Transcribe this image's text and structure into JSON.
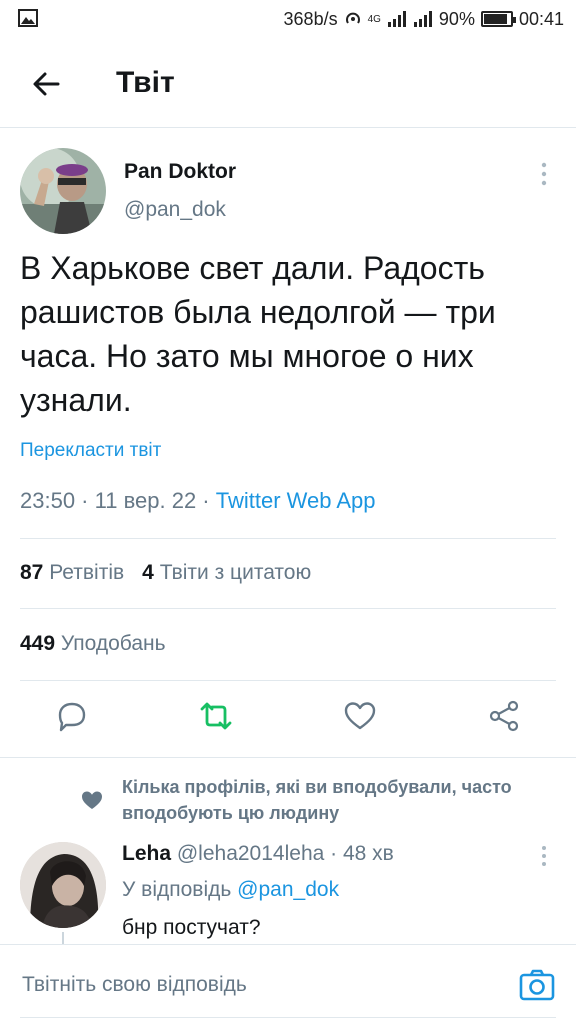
{
  "status_bar": {
    "speed": "368b/s",
    "network": "4G",
    "battery": "90%",
    "battery_level": 0.9,
    "time": "00:41"
  },
  "header": {
    "title": "Твіт"
  },
  "tweet": {
    "author_name": "Pan Doktor",
    "author_handle": "@pan_dok",
    "text": "В Харькове свет дали. Радость рашистов была недолгой — три часа. Но зато мы многое о них узнали.",
    "translate_label": "Перекласти твіт",
    "time": "23:50",
    "date": "11 вер. 22",
    "source": "Twitter Web App",
    "retweets_count": "87",
    "retweets_label": "Ретвітів",
    "quotes_count": "4",
    "quotes_label": "Твіти з цитатою",
    "likes_count": "449",
    "likes_label": "Уподобань"
  },
  "social_context": {
    "text": "Кілька профілів, які ви вподобували, часто вподобують цю людину"
  },
  "reply": {
    "name": "Leha",
    "handle": "@leha2014leha",
    "age": "48 хв",
    "replying_label": "У відповідь",
    "replying_to": "@pan_dok",
    "text": "бнр постучат?"
  },
  "compose": {
    "placeholder": "Твітніть свою відповідь"
  },
  "colors": {
    "accent": "#1b95e0",
    "retweet_active": "#17bf63",
    "secondary_text": "#657786",
    "divider": "#e1e8ed"
  }
}
